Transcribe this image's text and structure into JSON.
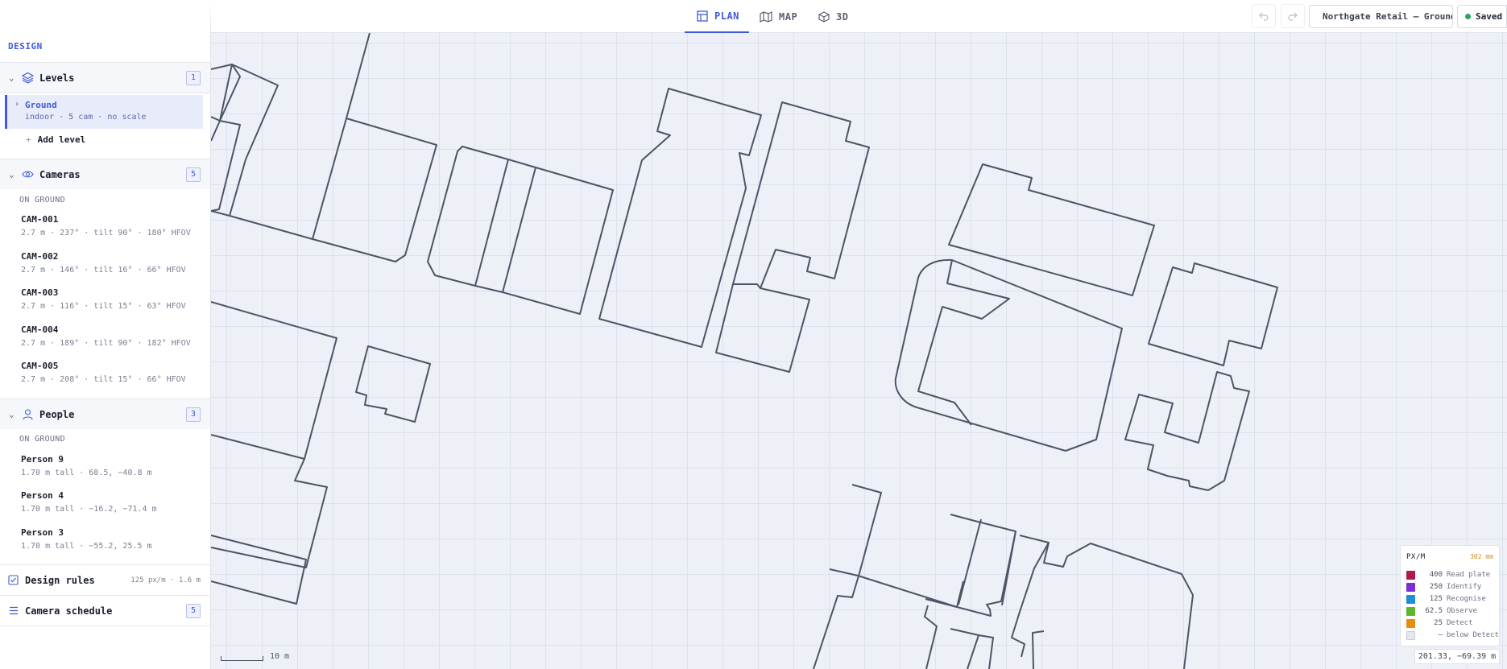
{
  "header": {
    "tabs": [
      {
        "label": "PLAN",
        "icon": "layout-icon",
        "active": true
      },
      {
        "label": "MAP",
        "icon": "map-icon",
        "active": false
      },
      {
        "label": "3D",
        "icon": "cube-icon",
        "active": false
      }
    ],
    "project_name": "Northgate Retail — Ground",
    "save_status": "Saved"
  },
  "sidebar": {
    "section_title": "DESIGN",
    "levels": {
      "label": "Levels",
      "count": "1",
      "items": [
        {
          "name": "Ground",
          "meta": "indoor · 5 cam · no scale"
        }
      ],
      "add_label": "Add level"
    },
    "cameras": {
      "label": "Cameras",
      "count": "5",
      "group_label": "ON GROUND",
      "items": [
        {
          "name": "CAM-001",
          "meta": "2.7 m · 237° · tilt 90° · 180° HFOV"
        },
        {
          "name": "CAM-002",
          "meta": "2.7 m · 146° · tilt 16° · 66° HFOV"
        },
        {
          "name": "CAM-003",
          "meta": "2.7 m · 116° · tilt 15° · 63° HFOV"
        },
        {
          "name": "CAM-004",
          "meta": "2.7 m · 189° · tilt 90° · 182° HFOV"
        },
        {
          "name": "CAM-005",
          "meta": "2.7 m · 208° · tilt 15° · 66° HFOV"
        }
      ]
    },
    "people": {
      "label": "People",
      "count": "3",
      "group_label": "ON GROUND",
      "items": [
        {
          "name": "Person 9",
          "meta": "1.70 m tall · 68.5, −40.8 m"
        },
        {
          "name": "Person 4",
          "meta": "1.70 m tall · −16.2, −71.4 m"
        },
        {
          "name": "Person 3",
          "meta": "1.70 m tall · −55.2, 25.5 m"
        }
      ]
    },
    "design_rules": {
      "label": "Design rules",
      "info": "125 px/m · 1.6 m"
    },
    "camera_schedule": {
      "label": "Camera schedule",
      "count": "5"
    }
  },
  "canvas": {
    "scale_label": "10 m",
    "legend": {
      "title": "PX/M",
      "value": "302 mm",
      "rows": [
        {
          "value": "400",
          "label": "Read plate",
          "color": "#b0184f"
        },
        {
          "value": "250",
          "label": "Identify",
          "color": "#7a2fd4"
        },
        {
          "value": "125",
          "label": "Recognise",
          "color": "#1e8fd6"
        },
        {
          "value": "62.5",
          "label": "Observe",
          "color": "#5cb82a"
        },
        {
          "value": "25",
          "label": "Detect",
          "color": "#e3900e"
        },
        {
          "value": "—",
          "label": "below Detect",
          "color": "#e6e8ee"
        }
      ]
    },
    "coordinates": "201.33, −69.39 m"
  },
  "colors": {
    "accent": "#3f5bd8",
    "outline": "#4d5466",
    "saved": "#22a85a"
  }
}
